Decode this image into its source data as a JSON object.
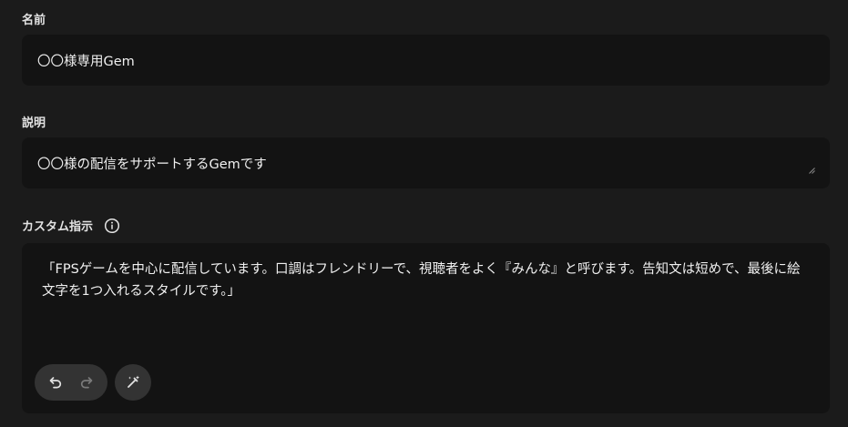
{
  "name_section": {
    "label": "名前",
    "value": "〇〇様専用Gem"
  },
  "description_section": {
    "label": "説明",
    "value": "〇〇様の配信をサポートするGemです"
  },
  "instructions_section": {
    "label": "カスタム指示",
    "value": "「FPSゲームを中心に配信しています。口調はフレンドリーで、視聴者をよく『みんな』と呼びます。告知文は短めで、最後に絵文字を1つ入れるスタイルです。」"
  },
  "toolbar": {
    "undo_icon": "undo-icon",
    "redo_icon": "redo-icon",
    "magic_icon": "magic-wand-pen-icon",
    "redo_enabled": false
  },
  "colors": {
    "background": "#1b1b1b",
    "field": "#131313",
    "button": "#333333"
  }
}
